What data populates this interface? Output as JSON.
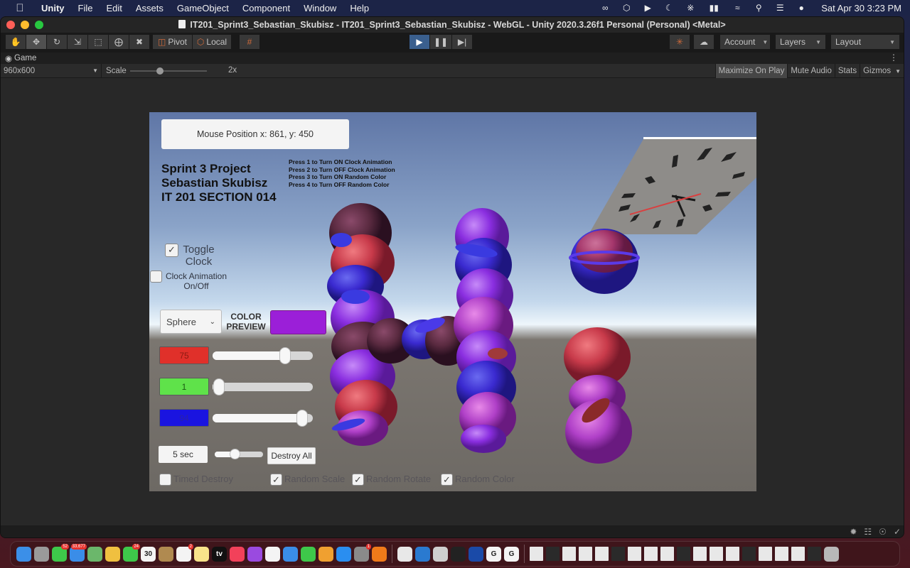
{
  "menubar": {
    "app_name": "Unity",
    "items": [
      "File",
      "Edit",
      "Assets",
      "GameObject",
      "Component",
      "Window",
      "Help"
    ],
    "status_icons": [
      "webex-icon",
      "unity-hub-icon",
      "play-circle-icon",
      "moon-icon",
      "bluetooth-icon",
      "battery-icon",
      "wifi-icon",
      "search-icon",
      "control-center-icon",
      "siri-icon"
    ],
    "datetime": "Sat Apr 30  3:23 PM"
  },
  "window": {
    "title": "IT201_Sprint3_Sebastian_Skubisz - IT201_Sprint3_Sebastian_Skubisz - WebGL - Unity 2020.3.26f1 Personal (Personal) <Metal>"
  },
  "toolbar": {
    "tools": [
      "hand-tool",
      "move-tool",
      "rotate-tool",
      "scale-tool",
      "rect-tool",
      "transform-tool",
      "custom-tool"
    ],
    "active_tool": "move-tool",
    "pivot_label": "Pivot",
    "local_label": "Local",
    "account_label": "Account",
    "layers_label": "Layers",
    "layout_label": "Layout"
  },
  "game_tab": {
    "label": "Game",
    "resolution": "960x600",
    "scale_label": "Scale",
    "scale_value": "2x",
    "maximize_on_play": "Maximize On Play",
    "mute_audio": "Mute Audio",
    "stats": "Stats",
    "gizmos": "Gizmos"
  },
  "game_ui": {
    "mouse_position": "Mouse Position x: 861, y: 450",
    "title_lines": [
      "Sprint 3 Project",
      "Sebastian Skubisz",
      "IT 201 SECTION 014"
    ],
    "instructions": [
      "Press 1 to Turn ON Clock Animation",
      "Press 2 to Turn OFF Clock Animation",
      "Press 3 to Turn ON Random Color",
      "Press 4 to Turn OFF Random Color"
    ],
    "toggle_clock": {
      "label_line1": "Toggle",
      "label_line2": "Clock",
      "checked": true
    },
    "clock_animation": {
      "label_line1": "Clock Animation",
      "label_line2": "On/Off",
      "checked": false
    },
    "shape_dropdown": "Sphere",
    "color_preview_label_line1": "COLOR",
    "color_preview_label_line2": "PREVIEW",
    "color_preview_hex": "#9b1fd8",
    "red": {
      "value": "75",
      "fraction": 0.75,
      "color": "#e0302a"
    },
    "green": {
      "value": "1",
      "fraction": 0.01,
      "color": "#5fe24a"
    },
    "blue": {
      "value": "94",
      "fraction": 0.94,
      "color": "#1a14e0"
    },
    "timer_label": "5 sec",
    "timer_fraction": 0.4,
    "destroy_all": "Destroy All",
    "checkboxes": [
      {
        "label": "Timed Destroy",
        "checked": false
      },
      {
        "label": "Random Scale",
        "checked": true
      },
      {
        "label": "Random Rotate",
        "checked": true
      },
      {
        "label": "Random Color",
        "checked": true
      }
    ]
  },
  "dock": {
    "apps": [
      {
        "name": "finder",
        "color": "#3b8fe8",
        "badge": ""
      },
      {
        "name": "launchpad",
        "color": "#9a9a9a",
        "badge": ""
      },
      {
        "name": "messages",
        "color": "#3ec84a",
        "badge": "52"
      },
      {
        "name": "mail",
        "color": "#3a8de8",
        "badge": "33,677"
      },
      {
        "name": "maps",
        "color": "#6bb76b",
        "badge": ""
      },
      {
        "name": "photos",
        "color": "#f0c040",
        "badge": ""
      },
      {
        "name": "facetime",
        "color": "#3ec84a",
        "badge": "24"
      },
      {
        "name": "calendar",
        "color": "#f4f4f4",
        "badge": "",
        "text": "30"
      },
      {
        "name": "contacts",
        "color": "#b08a50",
        "badge": ""
      },
      {
        "name": "reminders",
        "color": "#f4f4f4",
        "badge": "2"
      },
      {
        "name": "notes",
        "color": "#f8e38a",
        "badge": ""
      },
      {
        "name": "apple-tv",
        "color": "#111111",
        "badge": "",
        "text": "tv"
      },
      {
        "name": "music",
        "color": "#f2415a",
        "badge": ""
      },
      {
        "name": "podcasts",
        "color": "#9a4ae0",
        "badge": ""
      },
      {
        "name": "news",
        "color": "#f4f4f4",
        "badge": ""
      },
      {
        "name": "keynote",
        "color": "#3a8de8",
        "badge": ""
      },
      {
        "name": "numbers",
        "color": "#3ec84a",
        "badge": ""
      },
      {
        "name": "pages",
        "color": "#f0a030",
        "badge": ""
      },
      {
        "name": "app-store",
        "color": "#2a8ef0",
        "badge": ""
      },
      {
        "name": "system-preferences",
        "color": "#8a8a8a",
        "badge": "1"
      },
      {
        "name": "firefox",
        "color": "#f07a1a",
        "badge": ""
      }
    ],
    "apps2": [
      {
        "name": "chrome",
        "color": "#e8e8e8",
        "badge": ""
      },
      {
        "name": "vscode",
        "color": "#2a7ad0",
        "badge": ""
      },
      {
        "name": "unity-hub",
        "color": "#cfcfcf",
        "badge": ""
      },
      {
        "name": "unity",
        "color": "#222222",
        "badge": ""
      },
      {
        "name": "webex",
        "color": "#1a4aa8",
        "badge": ""
      },
      {
        "name": "g-app-1",
        "color": "#f4f4f4",
        "badge": "",
        "text": "G"
      },
      {
        "name": "g-app-2",
        "color": "#f4f4f4",
        "badge": "",
        "text": "G"
      }
    ]
  }
}
